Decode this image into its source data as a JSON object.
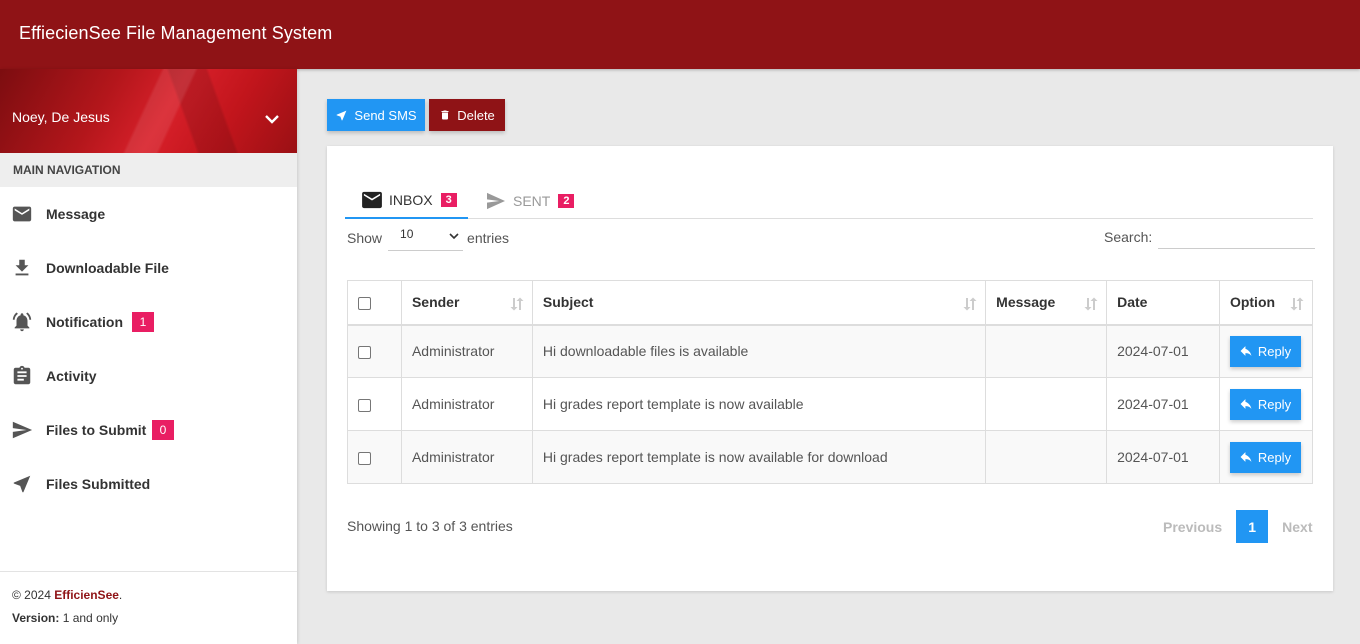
{
  "header": {
    "title": "EffiecienSee File Management System"
  },
  "user": {
    "name": "Noey, De Jesus"
  },
  "nav": {
    "header": "MAIN NAVIGATION",
    "items": [
      {
        "label": "Message",
        "icon": "mail-icon"
      },
      {
        "label": "Downloadable File",
        "icon": "download-icon"
      },
      {
        "label": "Notification",
        "icon": "bell-ring-icon",
        "badge": "1"
      },
      {
        "label": "Activity",
        "icon": "clipboard-icon"
      },
      {
        "label": "Files to Submit",
        "icon": "send-icon",
        "badge": "0"
      },
      {
        "label": "Files Submitted",
        "icon": "navigation-arrow-icon"
      }
    ]
  },
  "footer": {
    "copyright": "© 2024",
    "brand": "EfficienSee",
    "period": ".",
    "version_label": "Version:",
    "version_value": "1 and only"
  },
  "toolbar": {
    "send_sms": "Send SMS",
    "delete": "Delete"
  },
  "tabs": [
    {
      "label": "INBOX",
      "count": "3"
    },
    {
      "label": "SENT",
      "count": "2"
    }
  ],
  "table_controls": {
    "show": "Show",
    "length": "10",
    "entries": "entries",
    "search_label": "Search:",
    "search_value": ""
  },
  "table": {
    "columns": [
      "Sender",
      "Subject",
      "Message",
      "Date",
      "Option"
    ],
    "rows": [
      {
        "sender": "Administrator",
        "subject": "Hi downloadable files is available",
        "message": "",
        "date": "2024-07-01",
        "option": "Reply"
      },
      {
        "sender": "Administrator",
        "subject": "Hi grades report template is now available",
        "message": "",
        "date": "2024-07-01",
        "option": "Reply"
      },
      {
        "sender": "Administrator",
        "subject": "Hi grades report template is now available for download",
        "message": "",
        "date": "2024-07-01",
        "option": "Reply"
      }
    ]
  },
  "pagination": {
    "info": "Showing 1 to 3 of 3 entries",
    "previous": "Previous",
    "current": "1",
    "next": "Next"
  },
  "colors": {
    "brand": "#8f1316",
    "accent": "#2196f3",
    "badge": "#e91e63"
  }
}
